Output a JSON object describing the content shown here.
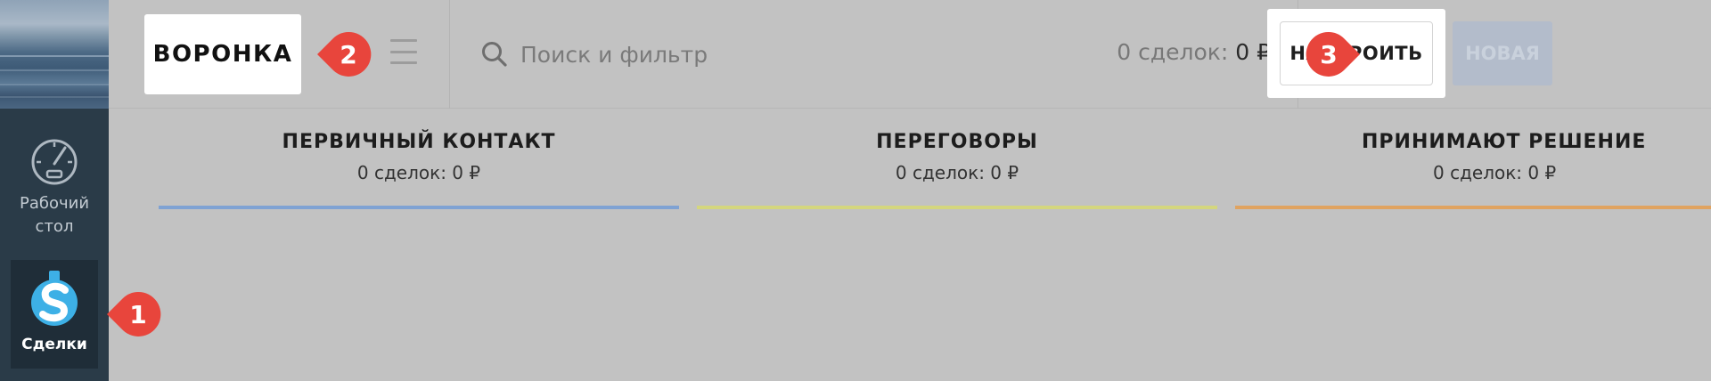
{
  "sidebar": {
    "items": [
      {
        "label": "Рабочий стол",
        "icon": "dashboard-gauge-icon"
      },
      {
        "label": "Сделки",
        "icon": "deals-dollar-icon",
        "active": true
      }
    ]
  },
  "header": {
    "pipeline_title": "ВОРОНКА",
    "menu_icon": "hamburger-icon",
    "search": {
      "icon": "search-icon",
      "placeholder": "Поиск и фильтр"
    },
    "summary": {
      "prefix": "0 сделок:",
      "amount": "0 ₽"
    },
    "setup_label": "НАСТРОИТЬ",
    "new_label": "НОВАЯ"
  },
  "stages": [
    {
      "name": "ПЕРВИЧНЫЙ КОНТАКТ",
      "summary": "0 сделок: 0 ₽",
      "color": "#7fa2d3"
    },
    {
      "name": "ПЕРЕГОВОРЫ",
      "summary": "0 сделок: 0 ₽",
      "color": "#d4d67e"
    },
    {
      "name": "ПРИНИМАЮТ РЕШЕНИЕ",
      "summary": "0 сделок: 0 ₽",
      "color": "#e0a360"
    }
  ],
  "callouts": [
    {
      "number": "1",
      "color": "#e8453c"
    },
    {
      "number": "2",
      "color": "#e8453c"
    },
    {
      "number": "3",
      "color": "#e8453c"
    }
  ]
}
